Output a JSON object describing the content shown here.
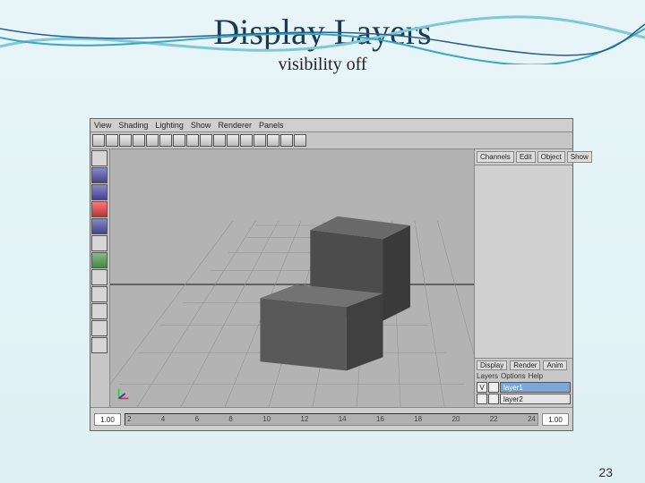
{
  "slide": {
    "title": "Display Layers",
    "subtitle": "visibility off",
    "page_number": "23"
  },
  "menubar": {
    "view": "View",
    "shading": "Shading",
    "lighting": "Lighting",
    "show": "Show",
    "renderer": "Renderer",
    "panels": "Panels"
  },
  "right_tabs": {
    "channels": "Channels",
    "edit": "Edit",
    "object": "Object",
    "show": "Show"
  },
  "layer_panel": {
    "tab_display": "Display",
    "tab_render": "Render",
    "tab_anim": "Anim",
    "opt_layers": "Layers",
    "opt_options": "Options",
    "opt_help": "Help",
    "vis_flag": "V",
    "layers": [
      {
        "name": "layer1",
        "visible": true,
        "selected": true
      },
      {
        "name": "layer2",
        "visible": false,
        "selected": false
      }
    ]
  },
  "timeline": {
    "ticks": [
      "2",
      "4",
      "6",
      "8",
      "10",
      "12",
      "14",
      "16",
      "18",
      "20",
      "22",
      "24"
    ],
    "start": "1.00",
    "end": "1.00"
  }
}
